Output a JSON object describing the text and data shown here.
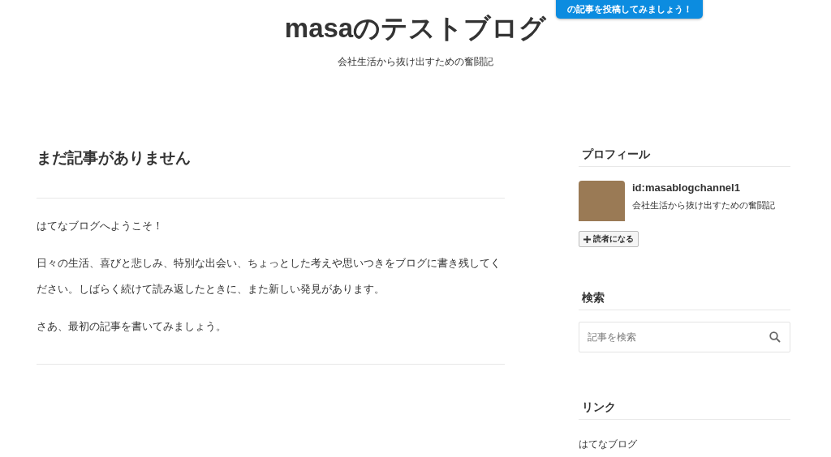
{
  "banner": {
    "label": "の記事を投稿してみましょう！"
  },
  "header": {
    "title": "masaのテストブログ",
    "tagline": "会社生活から抜け出すための奮闘記"
  },
  "article": {
    "title": "まだ記事がありません",
    "paragraphs": [
      "はてなブログへようこそ！",
      "日々の生活、喜びと悲しみ、特別な出会い、ちょっとした考えや思いつきをブログに書き残してください。しばらく続けて読み返したときに、また新しい発見があります。",
      "さあ、最初の記事を書いてみましょう。"
    ]
  },
  "sidebar": [
    {
      "kind": "profile",
      "title": "プロフィール",
      "user_id": "id:masablogchannel1",
      "description": "会社生活から抜け出すための奮闘記",
      "subscribe_label": "読者になる"
    },
    {
      "kind": "search",
      "title": "検索",
      "placeholder": "記事を検索"
    },
    {
      "kind": "links",
      "title": "リンク",
      "links": [
        "はてなブログ"
      ]
    }
  ]
}
